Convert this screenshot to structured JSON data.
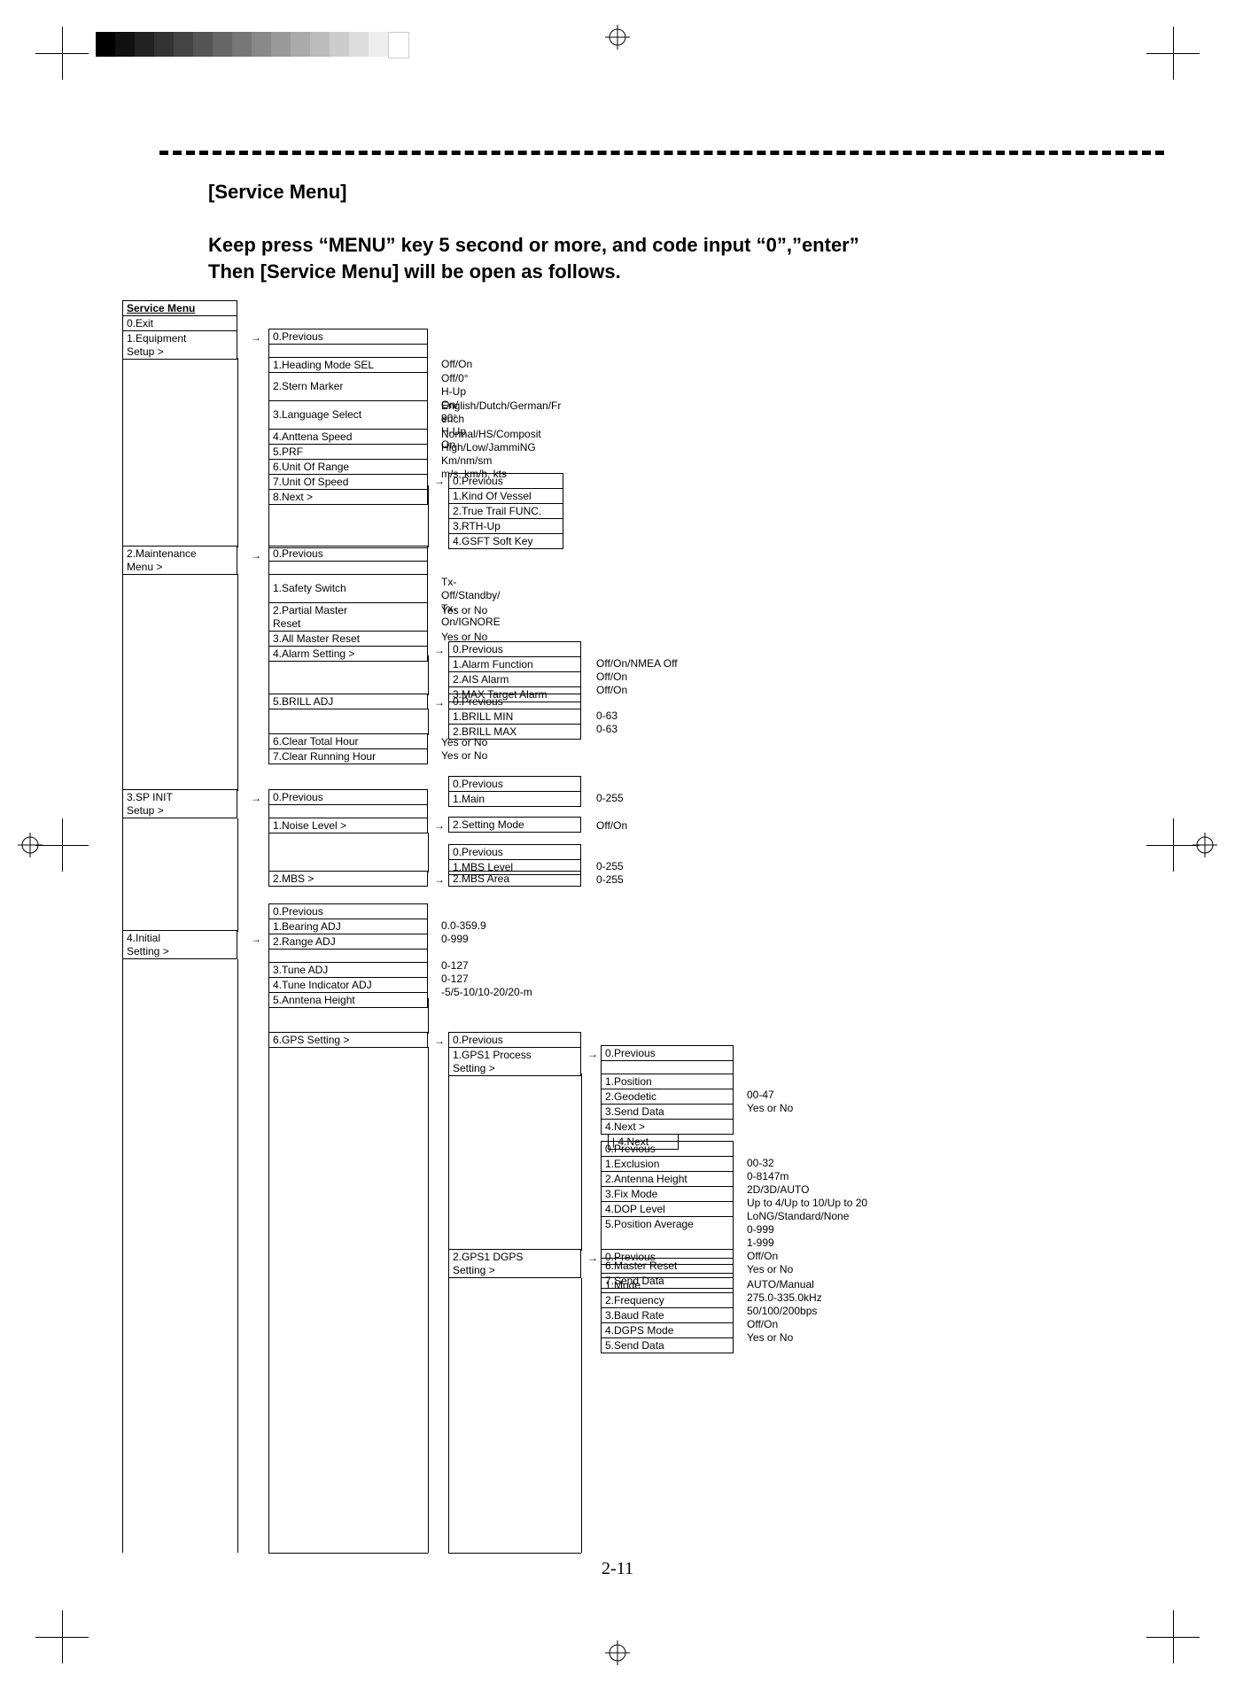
{
  "title": "[Service Menu]",
  "instruction": "Keep press “MENU” key 5 second or more, and code input “0”,”enter”\nThen [Service Menu] will be open as follows.",
  "pageNumber": "2-11",
  "colA": {
    "header": "Service Menu",
    "items": [
      "0.Exit",
      "1.Equipment",
      "  Setup  >",
      "2.Maintenance",
      "  Menu >",
      "3.SP INIT",
      "Setup        >",
      "4.Initial",
      "  Setting    >"
    ]
  },
  "equipSetup": {
    "items": [
      "0.Previous",
      "1.Heading Mode SEL",
      "2.Stern Marker",
      "3.Language Select",
      "4.Anttena Speed",
      "5.PRF",
      "6.Unit Of Range",
      "7.Unit Of Speed",
      "8.Next      >"
    ],
    "vals": [
      "",
      "Off/On",
      "Off/0°   H-Up On/\n90°   H-Up On",
      "English/Dutch/German/Fr\nench",
      "Normal/HS/Composit",
      "High/Low/JammiNG",
      "Km/nm/sm",
      "m/s, km/h, kts",
      ""
    ]
  },
  "equipNext": {
    "items": [
      "0.Previous",
      "1.Kind Of Vessel",
      "2.True Trail FUNC.",
      "3.RTH-Up",
      "4.GSFT Soft Key"
    ]
  },
  "maint": {
    "items": [
      "0.Previous",
      "1.Safety Switch",
      "2.Partial Master",
      "  Reset",
      "3.All Master Reset",
      "4.Alarm Setting >",
      "5.BRILL ADJ",
      "6.Clear Total Hour",
      "7.Clear Running Hour"
    ],
    "vals": [
      "",
      "Tx-Off/Standby/\nTx-On/IGNORE",
      "Yes or No",
      "",
      "Yes or No",
      "",
      "",
      "Yes or No",
      "Yes or No"
    ]
  },
  "alarm": {
    "items": [
      "0.Previous",
      "1.Alarm Function",
      "2.AIS Alarm",
      "3.MAX Target Alarm"
    ],
    "vals": [
      "",
      "Off/On/NMEA Off",
      "Off/On",
      "Off/On"
    ]
  },
  "brill": {
    "items": [
      "0.Previous",
      "1.BRILL MIN",
      "2.BRILL MAX"
    ],
    "vals": [
      "",
      "0-63",
      "0-63"
    ]
  },
  "spinit": {
    "items": [
      "0.Previous",
      "1.Noise Level           >",
      "2.MBS                    >"
    ]
  },
  "noise": {
    "items": [
      "0.Previous",
      "1.Main",
      "2.Setting Mode"
    ],
    "vals": [
      "",
      "0-255",
      "Off/On"
    ]
  },
  "mbs": {
    "items": [
      "0.Previous",
      "1.MBS Level",
      "2.MBS Area"
    ],
    "vals": [
      "",
      "0-255",
      "0-255"
    ]
  },
  "initial": {
    "items": [
      "0.Previous",
      "1.Bearing ADJ",
      "2.Range ADJ",
      "3.Tune ADJ",
      "4.Tune Indicator ADJ",
      "5.Anntena Height",
      "6.GPS Setting            >"
    ],
    "vals": [
      "",
      "0.0-359.9",
      "0-999",
      "0-127",
      "0-127",
      "-5/5-10/10-20/20-m",
      ""
    ]
  },
  "gps": {
    "items": [
      "0.Previous",
      "1.GPS1 Process",
      "  Setting >",
      "2.GPS1 DGPS",
      "  Setting  >"
    ]
  },
  "gps1a": {
    "items": [
      "0.Previous",
      "1.Position",
      "2.Geodetic",
      "3.Send Data",
      "4.Next      >",
      "  | 4.Next"
    ],
    "vals": [
      "",
      "",
      "00-47",
      "Yes or No",
      "",
      ""
    ]
  },
  "gps1b": {
    "items": [
      "0.Previous",
      "1.Exclusion",
      "2.Antenna Height",
      "3.Fix Mode",
      "4.DOP Level",
      "5.Position Average",
      "6.Master Reset",
      "7.Send Data"
    ],
    "vals": [
      "",
      "00-32",
      "0-8147m",
      "2D/3D/AUTO",
      "Up to 4/Up to 10/Up to 20",
      "LoNG/Standard/None\n0-999\n1-999",
      "Off/On",
      "Yes or No"
    ]
  },
  "dgps": {
    "items": [
      "0.Previous",
      "1.Mode",
      "2.Frequency",
      "3.Baud Rate",
      "4.DGPS Mode",
      "5.Send Data"
    ],
    "vals": [
      "",
      "AUTO/Manual",
      "275.0-335.0kHz",
      "50/100/200bps",
      "Off/On",
      "Yes or No"
    ]
  }
}
